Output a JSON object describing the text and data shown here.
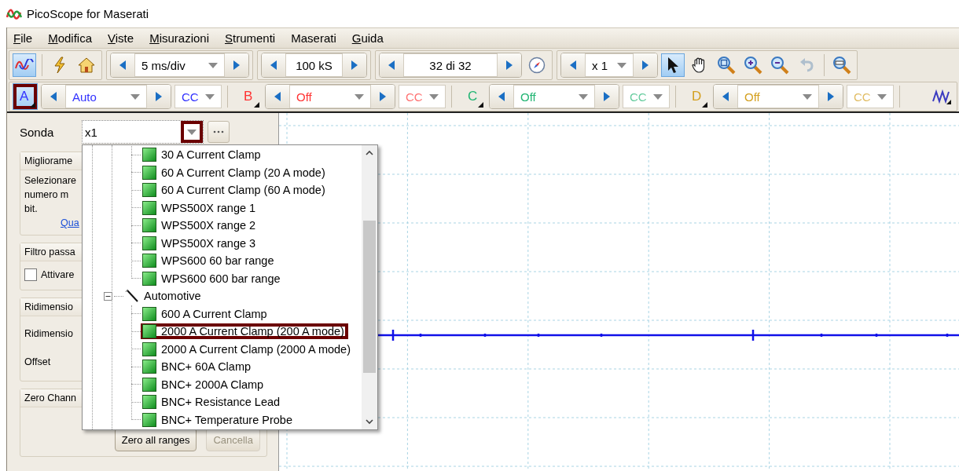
{
  "window": {
    "title": "PicoScope for Maserati"
  },
  "menu": [
    {
      "label": "File",
      "underline_first": true
    },
    {
      "label": "Modifica",
      "underline_first": true
    },
    {
      "label": "Viste",
      "underline_first": true
    },
    {
      "label": "Misurazioni",
      "underline_first": true
    },
    {
      "label": "Strumenti",
      "underline_first": true
    },
    {
      "label": "Maserati",
      "underline_first": false
    },
    {
      "label": "Guida",
      "underline_first": true
    }
  ],
  "toolbar": {
    "scope_mode": {
      "selected": true
    },
    "timebase": "5 ms/div",
    "samples": "100 kS",
    "buffer": "32 di 32",
    "zoom": "x 1",
    "tools": [
      {
        "kind": "pointer",
        "selected": true,
        "disabled": false
      },
      {
        "kind": "hand",
        "selected": false,
        "disabled": false
      },
      {
        "kind": "zoom-fit",
        "selected": false,
        "disabled": false
      },
      {
        "kind": "zoom-in",
        "selected": false,
        "disabled": false
      },
      {
        "kind": "zoom-out",
        "selected": false,
        "disabled": false
      },
      {
        "kind": "undo",
        "selected": false,
        "disabled": true
      },
      {
        "kind": "zoom-100",
        "selected": false,
        "disabled": false
      }
    ]
  },
  "channels": [
    {
      "label": "A",
      "color": "#3333ff",
      "range": "Auto",
      "coupling": "CC",
      "enabled": true,
      "selected": true,
      "highlighted": true
    },
    {
      "label": "B",
      "color": "#ff3333",
      "range": "Off",
      "coupling": "CC",
      "enabled": false,
      "selected": false,
      "highlighted": false
    },
    {
      "label": "C",
      "color": "#22b573",
      "range": "Off",
      "coupling": "CC",
      "enabled": false,
      "selected": false,
      "highlighted": false
    },
    {
      "label": "D",
      "color": "#d4a020",
      "range": "Off",
      "coupling": "CC",
      "enabled": false,
      "selected": false,
      "highlighted": false
    }
  ],
  "probe_panel": {
    "label": "Sonda",
    "value": "x1",
    "caret_highlighted": true,
    "sections": [
      {
        "kind": "text",
        "title": "Migliorame",
        "lines": [
          "Selezionare",
          "numero m",
          "bit."
        ],
        "link": "Qua"
      },
      {
        "kind": "checkbox",
        "title": "Filtro passa",
        "label": "Attivare",
        "checked": false
      },
      {
        "kind": "fields",
        "title": "Ridimensio",
        "fields": [
          "Ridimensio",
          "Offset"
        ]
      },
      {
        "kind": "buttons",
        "title": "Zero Chann",
        "buttons": [
          {
            "label": "Zero all ranges",
            "disabled": false
          },
          {
            "label": "Cancella",
            "disabled": true
          }
        ]
      }
    ]
  },
  "probe_list": {
    "groups": [
      {
        "children": [
          {
            "label": "30 A Current Clamp",
            "highlighted": false
          },
          {
            "label": "60 A Current Clamp (20 A mode)",
            "highlighted": false
          },
          {
            "label": "60 A Current Clamp (60 A mode)",
            "highlighted": false
          },
          {
            "label": "WPS500X range 1",
            "highlighted": false
          },
          {
            "label": "WPS500X range 2",
            "highlighted": false
          },
          {
            "label": "WPS500X range 3",
            "highlighted": false
          },
          {
            "label": "WPS600 60 bar range",
            "highlighted": false
          },
          {
            "label": "WPS600 600 bar range",
            "highlighted": false
          }
        ]
      },
      {
        "label": "Automotive",
        "expanded": true,
        "children": [
          {
            "label": "600 A Current Clamp",
            "highlighted": false
          },
          {
            "label": "2000 A Current Clamp (200 A mode)",
            "highlighted": true
          },
          {
            "label": "2000 A Current Clamp (2000 A mode)",
            "highlighted": false
          },
          {
            "label": "BNC+ 60A Clamp",
            "highlighted": false
          },
          {
            "label": "BNC+ 2000A Clamp",
            "highlighted": false
          },
          {
            "label": "BNC+ Resistance Lead",
            "highlighted": false
          },
          {
            "label": "BNC+ Temperature Probe",
            "highlighted": false
          }
        ]
      }
    ]
  }
}
